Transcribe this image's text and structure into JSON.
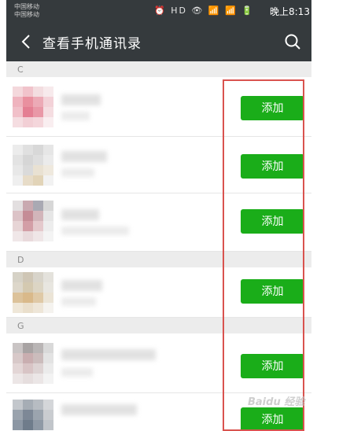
{
  "status_bar": {
    "carrier_1": "中国移动",
    "carrier_2": "中国移动",
    "icons": "⏰ HD 👁 📶 📶 🔋",
    "time": "晚上8:13"
  },
  "header": {
    "title": "查看手机通讯录",
    "back_icon": "back-chevron-icon",
    "search_icon": "search-icon"
  },
  "sections": [
    {
      "letter": "C"
    },
    {
      "letter": "D"
    },
    {
      "letter": "G"
    }
  ],
  "add_label": "添加",
  "watermark": "Baidu 经验",
  "colors": {
    "header_bg": "#353a3d",
    "add_button": "#1aad19",
    "highlight": "#d9534f"
  }
}
